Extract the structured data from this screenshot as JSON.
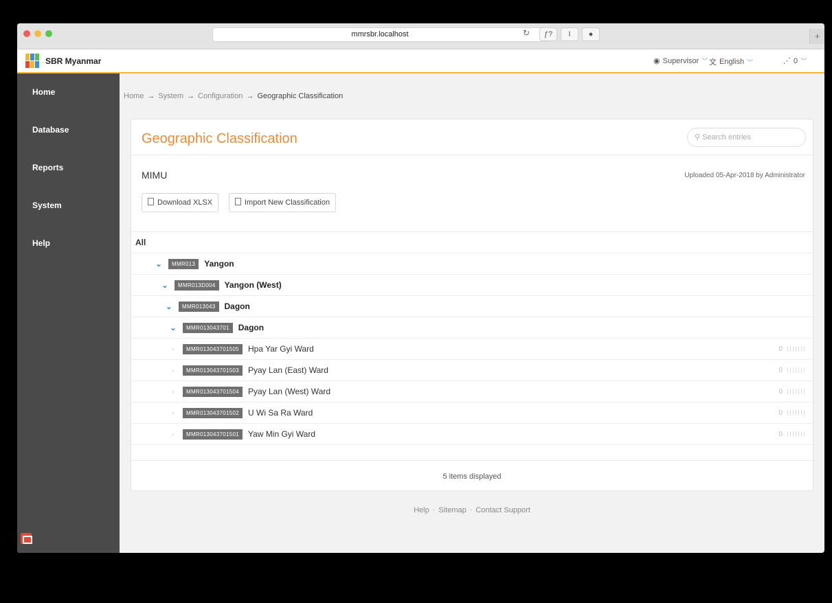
{
  "browser": {
    "url": "mmrsbr.localhost",
    "toolbar_buttons": [
      "ƒ?",
      "I",
      "●"
    ],
    "new_tab": "+"
  },
  "header": {
    "brand": "SBR Myanmar",
    "user_label": "Supervisor",
    "language_label": "English",
    "notifications_count": "0"
  },
  "sidebar": {
    "items": [
      {
        "label": "Home"
      },
      {
        "label": "Database"
      },
      {
        "label": "Reports"
      },
      {
        "label": "System"
      },
      {
        "label": "Help"
      }
    ]
  },
  "breadcrumb": [
    "Home",
    "System",
    "Configuration",
    "Geographic Classification"
  ],
  "panel": {
    "title": "Geographic Classification",
    "search_placeholder": "Search entries",
    "section_name": "MIMU",
    "uploaded_text": "Uploaded 05-Apr-2018 by Administrator",
    "download_button": "Download XLSX",
    "import_button": "Import New Classification",
    "tree_root": "All",
    "expanded_rows": [
      {
        "code": "MMR013",
        "name": "Yangon"
      },
      {
        "code": "MMR013D004",
        "name": "Yangon (West)"
      },
      {
        "code": "MMR013043",
        "name": "Dagon"
      },
      {
        "code": "MMR013043701",
        "name": "Dagon"
      }
    ],
    "leaf_rows": [
      {
        "code": "MMR013043701505",
        "name": "Hpa Yar Gyi Ward",
        "count": "0"
      },
      {
        "code": "MMR013043701503",
        "name": "Pyay Lan (East) Ward",
        "count": "0"
      },
      {
        "code": "MMR013043701504",
        "name": "Pyay Lan (West) Ward",
        "count": "0"
      },
      {
        "code": "MMR013043701502",
        "name": "U Wi Sa Ra Ward",
        "count": "0"
      },
      {
        "code": "MMR013043701501",
        "name": "Yaw Min Gyi Ward",
        "count": "0"
      }
    ],
    "items_displayed": "5 items displayed"
  },
  "footer": {
    "links": [
      "Help",
      "Sitemap",
      "Contact Support"
    ]
  }
}
